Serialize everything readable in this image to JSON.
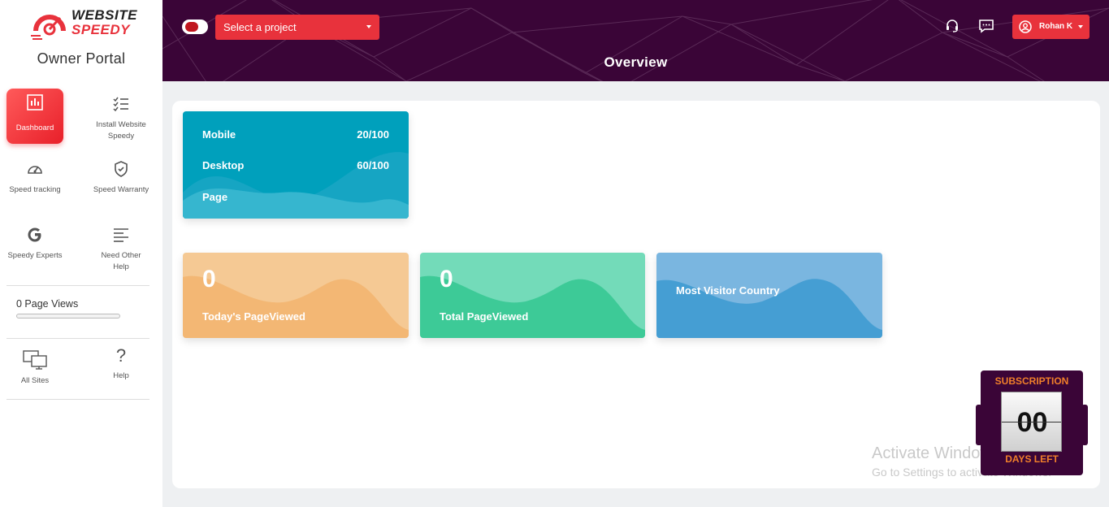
{
  "brand": {
    "line1": "WEBSITE",
    "line2": "SPEEDY",
    "portal": "Owner Portal"
  },
  "sidebar": {
    "items": [
      {
        "label": "Dashboard",
        "icon": "bar-chart-icon",
        "active": true
      },
      {
        "label": "Install Website Speedy",
        "icon": "checklist-icon"
      },
      {
        "label": "Speed tracking",
        "icon": "speedometer-icon"
      },
      {
        "label": "Speed Warranty",
        "icon": "shield-check-icon"
      },
      {
        "label": "Speedy Experts",
        "icon": "google-g-icon"
      },
      {
        "label": "Need Other Help",
        "icon": "lines-icon"
      }
    ],
    "page_views_label": "0 Page Views",
    "page_views_progress": 0,
    "bottom_items": [
      {
        "label": "All Sites",
        "icon": "monitors-icon"
      },
      {
        "label": "Help",
        "icon": "question-icon"
      }
    ]
  },
  "header": {
    "project_select": "Select a project",
    "title": "Overview",
    "user_name": "Rohan K",
    "icons": [
      "headset-icon",
      "chat-icon",
      "user-circle-icon"
    ],
    "background_color": "#3a0537",
    "accent_color": "#e8323c"
  },
  "overview_card": {
    "rows": [
      {
        "label": "Mobile",
        "value": "20/100"
      },
      {
        "label": "Desktop",
        "value": "60/100"
      },
      {
        "label": "Page",
        "value": ""
      }
    ]
  },
  "stat_cards": [
    {
      "value": "0",
      "label": "Today's PageViewed"
    },
    {
      "value": "0",
      "label": "Total PageViewed"
    },
    {
      "value": "",
      "label": "Most Visitor Country"
    }
  ],
  "watermark": {
    "line1": "Activate Windows",
    "line2": "Go to Settings to activate Windows."
  },
  "subscription": {
    "title": "SUBSCRIPTION",
    "days": "00",
    "days_label": "DAYS LEFT"
  }
}
